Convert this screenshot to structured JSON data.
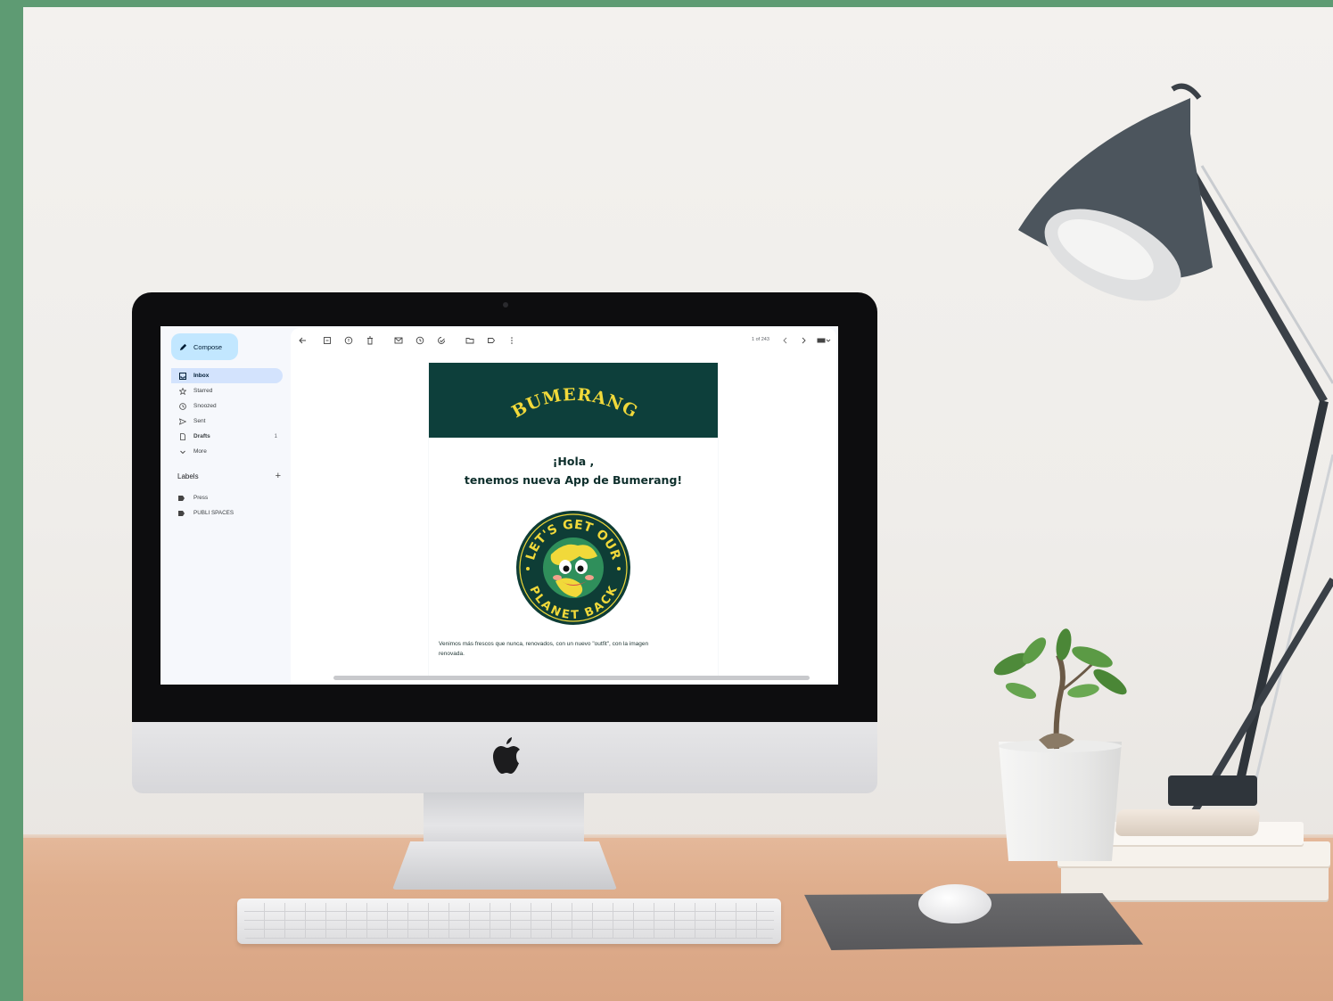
{
  "gmail": {
    "compose_label": "Compose",
    "nav": [
      {
        "label": "Inbox",
        "icon": "inbox-icon",
        "active": true
      },
      {
        "label": "Starred",
        "icon": "star-icon"
      },
      {
        "label": "Snoozed",
        "icon": "clock-icon"
      },
      {
        "label": "Sent",
        "icon": "send-icon"
      },
      {
        "label": "Drafts",
        "icon": "draft-icon",
        "count": "1"
      },
      {
        "label": "More",
        "icon": "chevron-down-icon"
      }
    ],
    "labels_title": "Labels",
    "labels_add": "+",
    "labels": [
      "Press",
      "PUBLI SPACES"
    ],
    "pager_text": "1 of 243"
  },
  "email": {
    "brand_text": "BUMERANG",
    "greeting_line1": "¡Hola ,",
    "greeting_line2": "tenemos nueva App de Bumerang!",
    "badge_top_text": "LET'S GET OUR",
    "badge_bottom_text": "PLANET BACK",
    "body_line1": "Venimos más frescos que nunca, renovados, con un nuevo \"outfit\", con la imagen",
    "body_line2": "renovada."
  },
  "colors": {
    "header_bg": "#0d3f3b",
    "brand_yellow": "#f1d93a",
    "compose_bg": "#c2e7ff",
    "active_nav_bg": "#d3e3fd",
    "frame_green": "#5e9b73"
  }
}
